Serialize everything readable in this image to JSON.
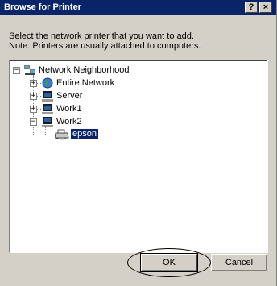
{
  "window": {
    "title": "Browse for Printer",
    "help_label": "?",
    "close_label": "×"
  },
  "description": {
    "line1": "Select the network printer that you want to add.",
    "line2": "Note: Printers are usually attached to computers."
  },
  "tree": {
    "root": {
      "label": "Network Neighborhood",
      "expander": "−",
      "icon": "network-neighborhood-icon"
    },
    "children": [
      {
        "label": "Entire Network",
        "expander": "+",
        "icon": "globe-icon"
      },
      {
        "label": "Server",
        "expander": "+",
        "icon": "computer-icon"
      },
      {
        "label": "Work1",
        "expander": "+",
        "icon": "computer-icon"
      },
      {
        "label": "Work2",
        "expander": "−",
        "icon": "computer-icon"
      }
    ],
    "printer": {
      "label": "epson",
      "icon": "printer-icon",
      "selected": true
    }
  },
  "buttons": {
    "ok_label": "OK",
    "cancel_label": "Cancel"
  },
  "colors": {
    "titlebar": "#0a246a",
    "selection": "#0a246a",
    "face": "#d4d0c8"
  }
}
